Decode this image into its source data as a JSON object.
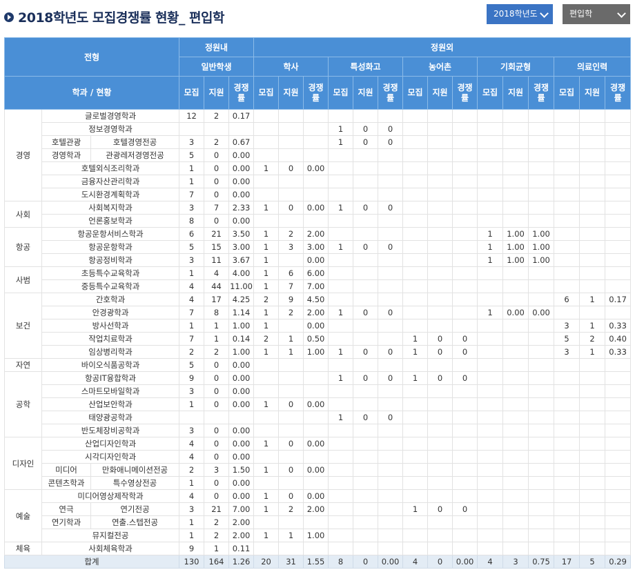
{
  "title": "2018학년도 모집경쟁률 현황_ 편입학",
  "selects": {
    "year": "2018학년도",
    "type": "편입학"
  },
  "header": {
    "jeonhyeong": "전형",
    "jeongwonnae": "정원내",
    "jeongwonoe": "정원외",
    "general": "일반학생",
    "groups": [
      "학사",
      "특성화고",
      "농어촌",
      "기회균형",
      "의료인력"
    ],
    "dept_status": "학과 / 현황",
    "mojip": "모집",
    "jiwon": "지원",
    "ratio_top": "경쟁",
    "ratio_bottom": "률"
  },
  "rows": [
    [
      "",
      "글로벌경영학과",
      "12",
      "2",
      "0.17",
      "",
      "",
      "",
      "",
      "",
      "",
      "",
      "",
      "",
      "",
      "",
      "",
      "",
      "",
      ""
    ],
    [
      "",
      "정보경영학과",
      "",
      "",
      "",
      "",
      "",
      "",
      "1",
      "0",
      "0",
      "",
      "",
      "",
      "",
      "",
      "",
      "",
      "",
      ""
    ],
    [
      "호텔관광",
      "호텔경영전공",
      "3",
      "2",
      "0.67",
      "",
      "",
      "",
      "1",
      "0",
      "0",
      "",
      "",
      "",
      "",
      "",
      "",
      "",
      "",
      ""
    ],
    [
      "경영학과",
      "관광레저경영전공",
      "5",
      "0",
      "0.00",
      "",
      "",
      "",
      "",
      "",
      "",
      "",
      "",
      "",
      "",
      "",
      "",
      "",
      "",
      ""
    ],
    [
      "",
      "호텔외식조리학과",
      "1",
      "0",
      "0.00",
      "1",
      "0",
      "0.00",
      "",
      "",
      "",
      "",
      "",
      "",
      "",
      "",
      "",
      "",
      "",
      ""
    ],
    [
      "",
      "금융자산관리학과",
      "1",
      "0",
      "0.00",
      "",
      "",
      "",
      "",
      "",
      "",
      "",
      "",
      "",
      "",
      "",
      "",
      "",
      "",
      ""
    ],
    [
      "",
      "도시환경계획학과",
      "7",
      "0",
      "0.00",
      "",
      "",
      "",
      "",
      "",
      "",
      "",
      "",
      "",
      "",
      "",
      "",
      "",
      "",
      ""
    ],
    [
      "",
      "사회복지학과",
      "3",
      "7",
      "2.33",
      "1",
      "0",
      "0.00",
      "1",
      "0",
      "0",
      "",
      "",
      "",
      "",
      "",
      "",
      "",
      "",
      ""
    ],
    [
      "",
      "언론홍보학과",
      "8",
      "0",
      "0.00",
      "",
      "",
      "",
      "",
      "",
      "",
      "",
      "",
      "",
      "",
      "",
      "",
      "",
      "",
      ""
    ],
    [
      "",
      "항공운항서비스학과",
      "6",
      "21",
      "3.50",
      "1",
      "2",
      "2.00",
      "",
      "",
      "",
      "",
      "",
      "",
      "1",
      "1.00",
      "1.00",
      "",
      "",
      ""
    ],
    [
      "",
      "항공운항학과",
      "5",
      "15",
      "3.00",
      "1",
      "3",
      "3.00",
      "1",
      "0",
      "0",
      "",
      "",
      "",
      "1",
      "1.00",
      "1.00",
      "",
      "",
      ""
    ],
    [
      "",
      "항공정비학과",
      "3",
      "11",
      "3.67",
      "1",
      "",
      "0.00",
      "",
      "",
      "",
      "",
      "",
      "",
      "1",
      "1.00",
      "1.00",
      "",
      "",
      ""
    ],
    [
      "",
      "초등특수교육학과",
      "1",
      "4",
      "4.00",
      "1",
      "6",
      "6.00",
      "",
      "",
      "",
      "",
      "",
      "",
      "",
      "",
      "",
      "",
      "",
      ""
    ],
    [
      "",
      "중등특수교육학과",
      "4",
      "44",
      "11.00",
      "1",
      "7",
      "7.00",
      "",
      "",
      "",
      "",
      "",
      "",
      "",
      "",
      "",
      "",
      "",
      ""
    ],
    [
      "",
      "간호학과",
      "4",
      "17",
      "4.25",
      "2",
      "9",
      "4.50",
      "",
      "",
      "",
      "",
      "",
      "",
      "",
      "",
      "",
      "6",
      "1",
      "0.17"
    ],
    [
      "",
      "안경광학과",
      "7",
      "8",
      "1.14",
      "1",
      "2",
      "2.00",
      "1",
      "0",
      "0",
      "",
      "",
      "",
      "1",
      "0.00",
      "0.00",
      "",
      "",
      ""
    ],
    [
      "",
      "방사선학과",
      "1",
      "1",
      "1.00",
      "1",
      "",
      "0.00",
      "",
      "",
      "",
      "",
      "",
      "",
      "",
      "",
      "",
      "3",
      "1",
      "0.33"
    ],
    [
      "",
      "작업치료학과",
      "7",
      "1",
      "0.14",
      "2",
      "1",
      "0.50",
      "",
      "",
      "",
      "1",
      "0",
      "0",
      "",
      "",
      "",
      "5",
      "2",
      "0.40"
    ],
    [
      "",
      "임상병리학과",
      "2",
      "2",
      "1.00",
      "1",
      "1",
      "1.00",
      "1",
      "0",
      "0",
      "1",
      "0",
      "0",
      "",
      "",
      "",
      "3",
      "1",
      "0.33"
    ],
    [
      "",
      "바이오식품공학과",
      "5",
      "0",
      "0.00",
      "",
      "",
      "",
      "",
      "",
      "",
      "",
      "",
      "",
      "",
      "",
      "",
      "",
      "",
      ""
    ],
    [
      "",
      "항공IT융합학과",
      "9",
      "0",
      "0.00",
      "",
      "",
      "",
      "1",
      "0",
      "0",
      "1",
      "0",
      "0",
      "",
      "",
      "",
      "",
      "",
      ""
    ],
    [
      "",
      "스마트모바일학과",
      "3",
      "0",
      "0.00",
      "",
      "",
      "",
      "",
      "",
      "",
      "",
      "",
      "",
      "",
      "",
      "",
      "",
      "",
      ""
    ],
    [
      "",
      "산업보안학과",
      "1",
      "0",
      "0.00",
      "1",
      "0",
      "0.00",
      "",
      "",
      "",
      "",
      "",
      "",
      "",
      "",
      "",
      "",
      "",
      ""
    ],
    [
      "",
      "태양광공학과",
      "",
      "",
      "",
      "",
      "",
      "",
      "1",
      "0",
      "0",
      "",
      "",
      "",
      "",
      "",
      "",
      "",
      "",
      ""
    ],
    [
      "",
      "반도체장비공학과",
      "3",
      "0",
      "0.00",
      "",
      "",
      "",
      "",
      "",
      "",
      "",
      "",
      "",
      "",
      "",
      "",
      "",
      "",
      ""
    ],
    [
      "",
      "산업디자인학과",
      "4",
      "0",
      "0.00",
      "1",
      "0",
      "0.00",
      "",
      "",
      "",
      "",
      "",
      "",
      "",
      "",
      "",
      "",
      "",
      ""
    ],
    [
      "",
      "시각디자인학과",
      "4",
      "0",
      "0.00",
      "",
      "",
      "",
      "",
      "",
      "",
      "",
      "",
      "",
      "",
      "",
      "",
      "",
      "",
      ""
    ],
    [
      "미디어",
      "만화애니메이션전공",
      "2",
      "3",
      "1.50",
      "1",
      "0",
      "0.00",
      "",
      "",
      "",
      "",
      "",
      "",
      "",
      "",
      "",
      "",
      "",
      ""
    ],
    [
      "콘텐츠학과",
      "특수영상전공",
      "1",
      "0",
      "0.00",
      "",
      "",
      "",
      "",
      "",
      "",
      "",
      "",
      "",
      "",
      "",
      "",
      "",
      "",
      ""
    ],
    [
      "",
      "미디어영상제작학과",
      "4",
      "0",
      "0.00",
      "1",
      "0",
      "0.00",
      "",
      "",
      "",
      "",
      "",
      "",
      "",
      "",
      "",
      "",
      "",
      ""
    ],
    [
      "연극",
      "연기전공",
      "3",
      "21",
      "7.00",
      "1",
      "2",
      "2.00",
      "",
      "",
      "",
      "1",
      "0",
      "0",
      "",
      "",
      "",
      "",
      "",
      ""
    ],
    [
      "연기학과",
      "연출.스텝전공",
      "1",
      "2",
      "2.00",
      "",
      "",
      "",
      "",
      "",
      "",
      "",
      "",
      "",
      "",
      "",
      "",
      "",
      "",
      ""
    ],
    [
      "",
      "뮤지컬전공",
      "1",
      "2",
      "2.00",
      "1",
      "1",
      "1.00",
      "",
      "",
      "",
      "",
      "",
      "",
      "",
      "",
      "",
      "",
      "",
      ""
    ],
    [
      "",
      "사회체육학과",
      "9",
      "1",
      "0.11",
      "",
      "",
      "",
      "",
      "",
      "",
      "",
      "",
      "",
      "",
      "",
      "",
      "",
      "",
      ""
    ]
  ],
  "groups": [
    {
      "label": "경영",
      "span": 7
    },
    {
      "label": "사회",
      "span": 2
    },
    {
      "label": "항공",
      "span": 3
    },
    {
      "label": "사범",
      "span": 2
    },
    {
      "label": "보건",
      "span": 5
    },
    {
      "label": "자연",
      "span": 1
    },
    {
      "label": "공학",
      "span": 5
    },
    {
      "label": "디자인",
      "span": 4
    },
    {
      "label": "예술",
      "span": 4
    },
    {
      "label": "체육",
      "span": 1
    }
  ],
  "total": [
    "합계",
    "130",
    "164",
    "1.26",
    "20",
    "31",
    "1.55",
    "8",
    "0",
    "0.00",
    "4",
    "0",
    "0.00",
    "4",
    "3",
    "0.75",
    "17",
    "5",
    "0.29"
  ]
}
